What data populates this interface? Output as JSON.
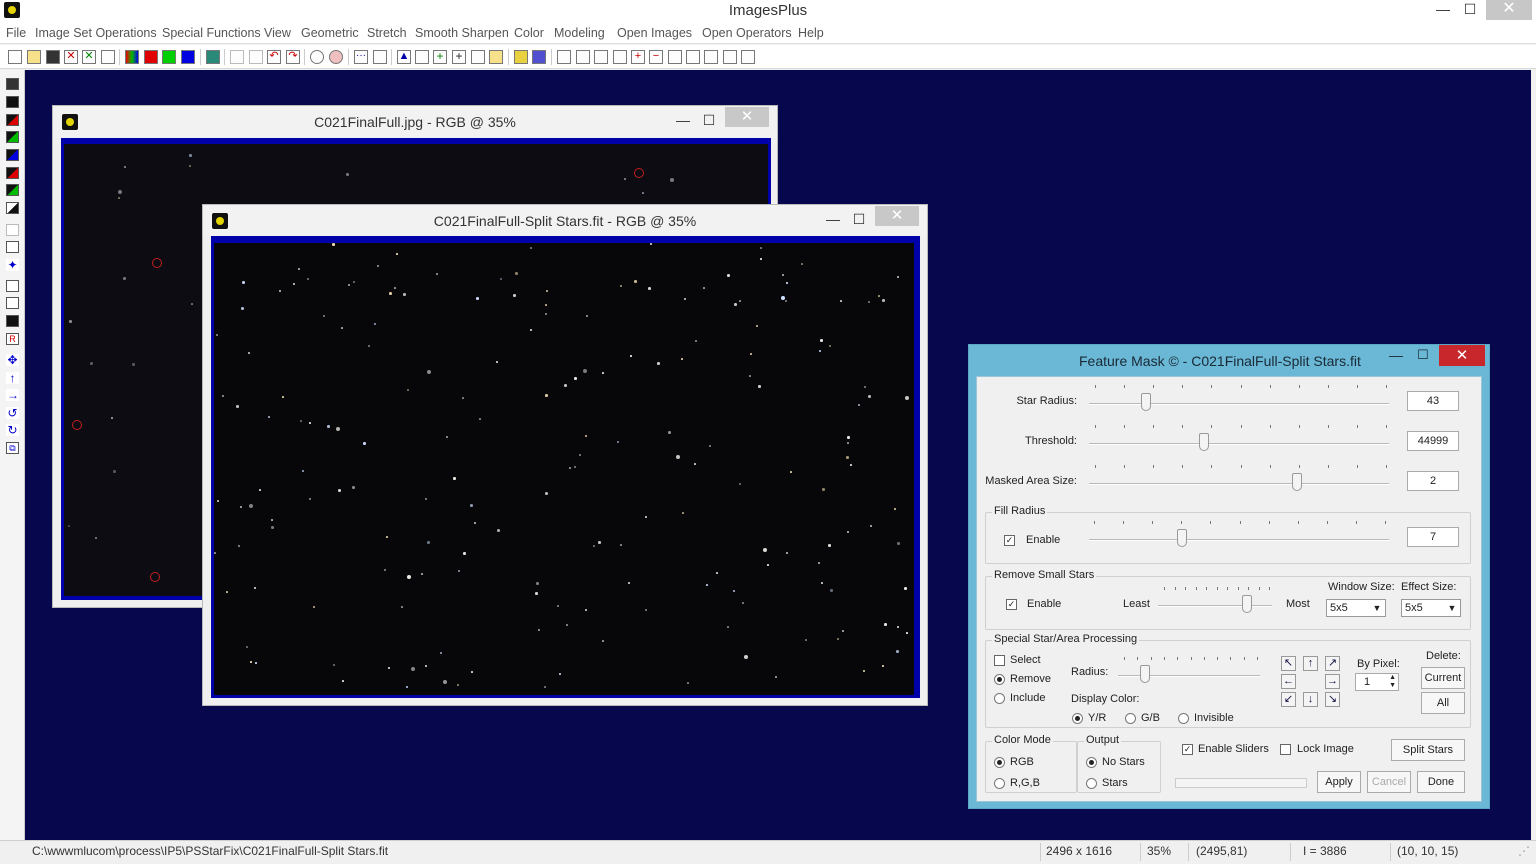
{
  "app": {
    "title": "ImagesPlus"
  },
  "menu": [
    "File",
    "Image Set Operations",
    "Special Functions",
    "View",
    "Geometric",
    "Stretch",
    "Smooth Sharpen",
    "Color",
    "Modeling",
    "Open Images",
    "Open Operators",
    "Help"
  ],
  "window_buttons": {
    "minimize": "—",
    "maximize": "☐",
    "close": "✕"
  },
  "image_windows": [
    {
      "title": "C021FinalFull.jpg - RGB @ 35%"
    },
    {
      "title": "C021FinalFull-Split Stars.fit - RGB @ 35%"
    }
  ],
  "dialog": {
    "title": "Feature Mask © - C021FinalFull-Split Stars.fit",
    "star_radius": {
      "label": "Star Radius:",
      "value": "43"
    },
    "threshold": {
      "label": "Threshold:",
      "value": "44999"
    },
    "masked_area": {
      "label": "Masked Area Size:",
      "value": "2"
    },
    "fill_radius": {
      "group": "Fill Radius",
      "enable_label": "Enable",
      "enabled": true,
      "value": "7"
    },
    "remove_small": {
      "group": "Remove Small Stars",
      "enable_label": "Enable",
      "enabled": true,
      "least": "Least",
      "most": "Most",
      "window_label": "Window Size:",
      "window_value": "5x5",
      "effect_label": "Effect Size:",
      "effect_value": "5x5"
    },
    "special": {
      "group": "Special Star/Area Processing",
      "select": "Select",
      "remove": "Remove",
      "include": "Include",
      "selected_mode": "Remove",
      "radius_label": "Radius:",
      "display_color_label": "Display Color:",
      "color_yr": "Y/R",
      "color_gb": "G/B",
      "color_invisible": "Invisible",
      "selected_color": "Y/R",
      "by_pixel_label": "By Pixel:",
      "by_pixel_value": "1",
      "delete_label": "Delete:",
      "current_btn": "Current",
      "all_btn": "All"
    },
    "color_mode": {
      "group": "Color Mode",
      "rgb": "RGB",
      "r_g_b": "R,G,B",
      "selected": "RGB"
    },
    "output": {
      "group": "Output",
      "no_stars": "No Stars",
      "stars": "Stars",
      "selected": "No Stars"
    },
    "enable_sliders": {
      "label": "Enable Sliders",
      "checked": true
    },
    "lock_image": {
      "label": "Lock Image",
      "checked": false
    },
    "buttons": {
      "split_stars": "Split Stars",
      "apply": "Apply",
      "cancel": "Cancel",
      "done": "Done"
    }
  },
  "status": {
    "path": "C:\\wwwmlucom\\process\\IP5\\PSStarFix\\C021FinalFull-Split Stars.fit",
    "dimensions": "2496 x 1616",
    "zoom": "35%",
    "coords": "(2495,81)",
    "intensity": "I = 3886",
    "rgb": "(10, 10, 15)"
  },
  "colors": {
    "workspace": "#07074e",
    "dialog_frame": "#6ab7d6",
    "image_frame": "#0000a8",
    "close_red": "#c8272c"
  }
}
